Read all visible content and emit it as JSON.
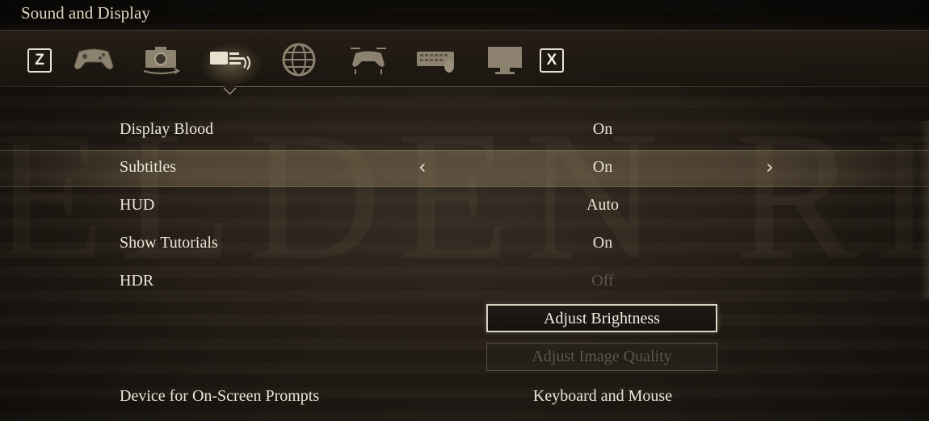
{
  "header": {
    "title": "Sound and Display",
    "watermark": "ELDEN RING"
  },
  "tabs": {
    "prev_key": "Z",
    "next_key": "X",
    "items": [
      {
        "icon": "gamepad-icon"
      },
      {
        "icon": "camera-icon"
      },
      {
        "icon": "sound-display-icon",
        "selected": true
      },
      {
        "icon": "globe-icon"
      },
      {
        "icon": "controller-settings-icon"
      },
      {
        "icon": "keyboard-mouse-icon"
      },
      {
        "icon": "monitor-icon"
      }
    ]
  },
  "settings": {
    "rows": [
      {
        "label": "Display Blood",
        "value": "On"
      },
      {
        "label": "Subtitles",
        "value": "On",
        "selected": true,
        "prev_arrow": "‹",
        "next_arrow": "›"
      },
      {
        "label": "HUD",
        "value": "Auto"
      },
      {
        "label": "Show Tutorials",
        "value": "On"
      },
      {
        "label": "HDR",
        "value": "Off",
        "disabled": true
      },
      {
        "label": "Device for On-Screen Prompts",
        "value": "Keyboard and Mouse"
      }
    ],
    "buttons": {
      "adjust_brightness": "Adjust Brightness",
      "adjust_image_quality": "Adjust Image Quality"
    }
  },
  "colors": {
    "text": "#ece6d8",
    "disabled_text": "#5e564a",
    "highlight": "#968264",
    "background": "#1b1611"
  }
}
